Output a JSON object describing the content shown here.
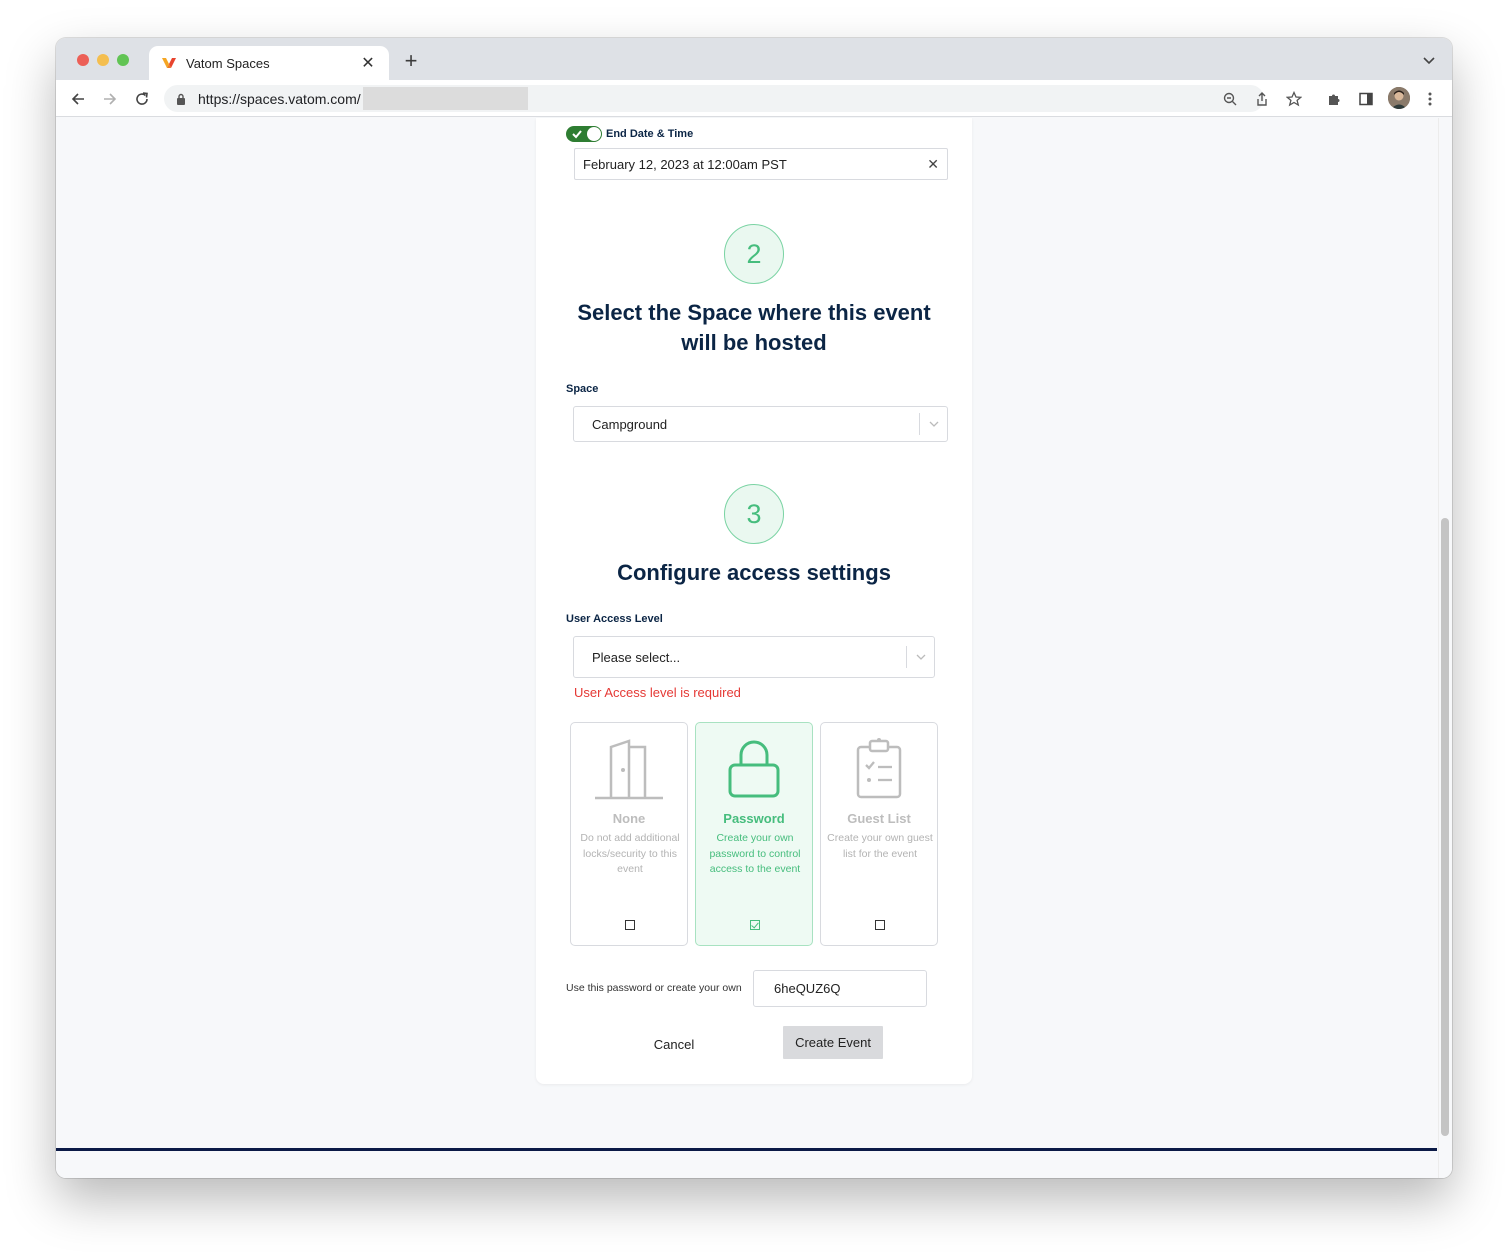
{
  "browser": {
    "tab_title": "Vatom Spaces",
    "url_text": "https://spaces.vatom.com/",
    "favicon": "vatom-logo-icon"
  },
  "form": {
    "end_date_label": "End Date & Time",
    "end_date_value": "February 12, 2023 at 12:00am PST",
    "step2_number": "2",
    "step2_heading_line1": "Select the Space where this event",
    "step2_heading_line2": "will be hosted",
    "space_label": "Space",
    "space_value": "Campground",
    "step3_number": "3",
    "step3_heading": "Configure access settings",
    "access_label": "User Access Level",
    "access_placeholder": "Please select...",
    "access_error": "User Access level is required",
    "options": [
      {
        "title": "None",
        "desc": "Do not add additional locks/security to this event",
        "icon": "door-icon",
        "selected": false
      },
      {
        "title": "Password",
        "desc": "Create your own password to control access to the event",
        "icon": "lock-icon",
        "selected": true
      },
      {
        "title": "Guest List",
        "desc": "Create your own guest list for the event",
        "icon": "clipboard-checklist-icon",
        "selected": false
      }
    ],
    "password_label": "Use this password or create your own",
    "password_value": "6heQUZ6Q",
    "cancel_label": "Cancel",
    "create_label": "Create Event"
  },
  "colors": {
    "accent_green": "#46bd7d",
    "heading_navy": "#0b2545",
    "error_red": "#e53935",
    "toggle_green": "#2e7d32"
  }
}
